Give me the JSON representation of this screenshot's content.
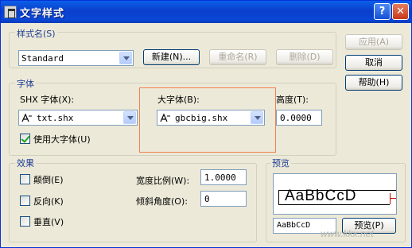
{
  "window": {
    "title": "文字样式",
    "help_glyph": "?",
    "close_glyph": "✕"
  },
  "style_name": {
    "group_label": "样式名(S)",
    "current": "Standard",
    "new_button": "新建(N)...",
    "rename_button": "重命名(R)",
    "delete_button": "删除(D)"
  },
  "buttons": {
    "apply": "应用(A)",
    "cancel": "取消",
    "help": "帮助(H)"
  },
  "font": {
    "group_label": "字体",
    "shx_label": "SHX 字体(X):",
    "shx_value": "txt.shx",
    "big_label": "大字体(B):",
    "big_value": "gbcbig.shx",
    "height_label": "高度(T):",
    "height_value": "0.0000",
    "use_big_label": "使用大字体(U)",
    "use_big_checked": true
  },
  "effects": {
    "group_label": "效果",
    "upside_down": "颠倒(E)",
    "backwards": "反向(K)",
    "vertical": "垂直(V)",
    "width_factor_label": "宽度比例(W):",
    "width_factor_value": "1.0000",
    "oblique_label": "倾斜角度(O):",
    "oblique_value": "0"
  },
  "preview": {
    "group_label": "预览",
    "sample_text": "AaBbCcD",
    "input_value": "AaBbCcD",
    "button": "预览(P)"
  },
  "watermark": {
    "text": "www.kkx.net"
  }
}
